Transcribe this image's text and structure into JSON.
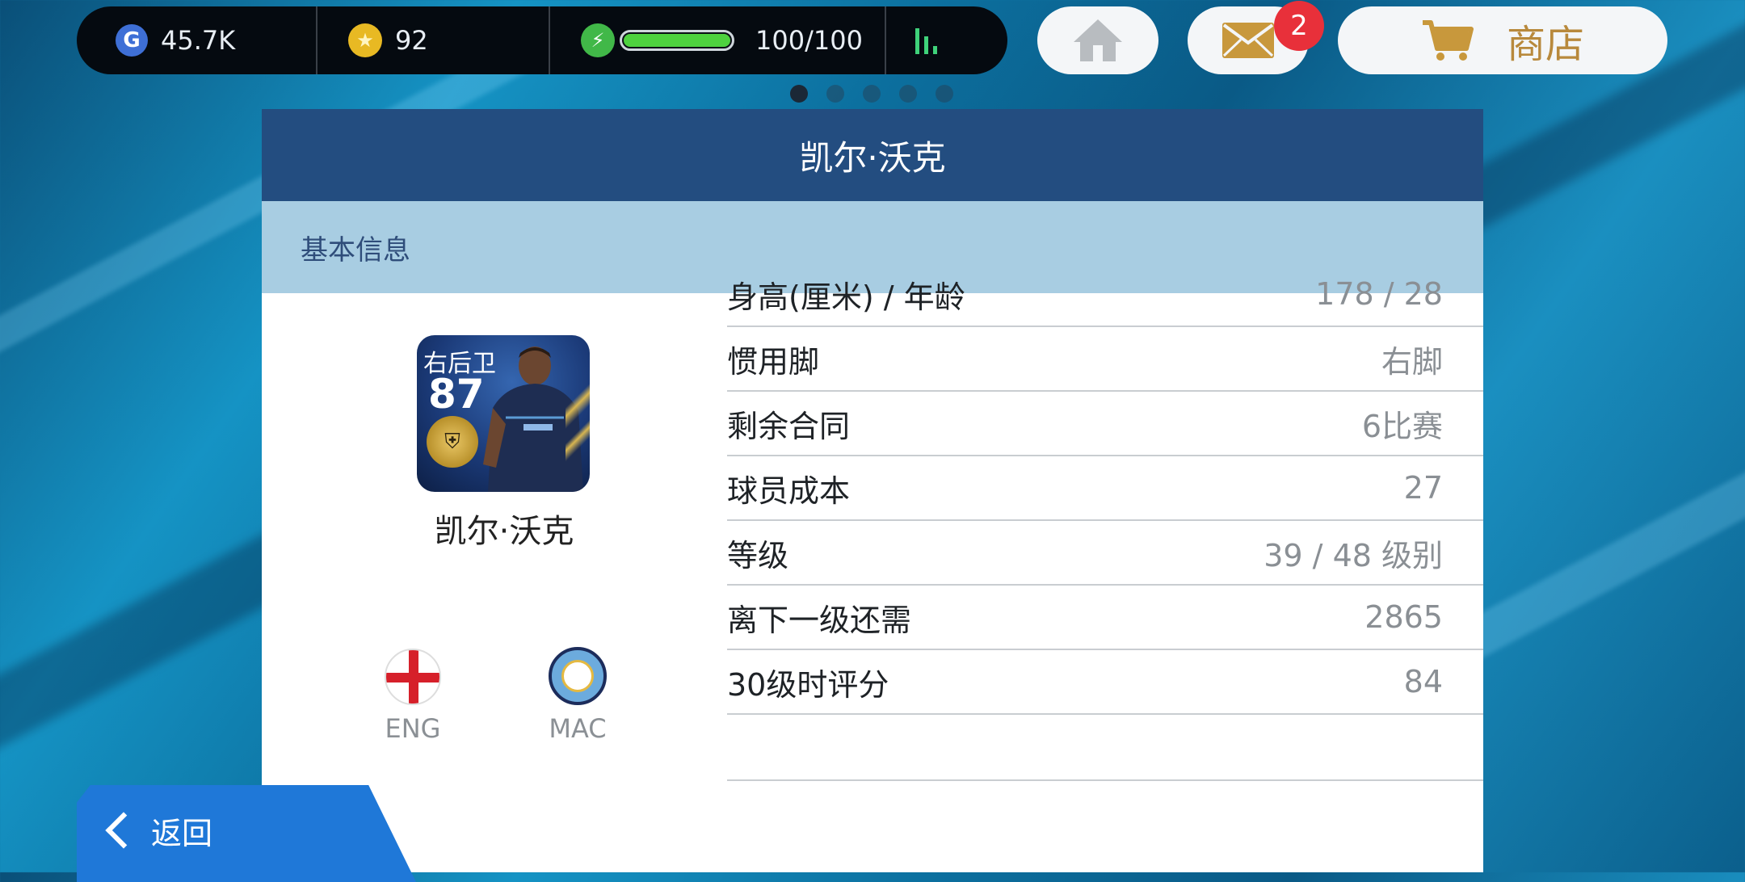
{
  "topbar": {
    "gp": "45.7K",
    "coins": "92",
    "energy_text": "100/100",
    "energy_fraction": 1.0,
    "icons": [
      "g-icon",
      "coin-icon",
      "lightning-icon",
      "signal-icon"
    ]
  },
  "nav": {
    "mail_badge": "2",
    "shop_label": "商店",
    "icons": [
      "home-icon",
      "mail-icon",
      "cart-icon"
    ]
  },
  "page": {
    "title": "凯尔·沃克",
    "section": "基本信息",
    "page_count": 5,
    "active_page": 1
  },
  "player": {
    "position": "右后卫",
    "rating": "87",
    "name": "凯尔·沃克",
    "nation_code": "ENG",
    "club_code": "MAC"
  },
  "info_rows": [
    {
      "label": "身高(厘米) / 年龄",
      "value": "178 / 28"
    },
    {
      "label": "惯用脚",
      "value": "右脚"
    },
    {
      "label": "剩余合同",
      "value": "6比赛"
    },
    {
      "label": "球员成本",
      "value": "27"
    },
    {
      "label": "等级",
      "value": "39 / 48 级别"
    },
    {
      "label": "离下一级还需",
      "value": "2865"
    },
    {
      "label": "30级时评分",
      "value": "84"
    }
  ],
  "back": {
    "label": "返回"
  },
  "colors": {
    "header": "#234d80",
    "section": "#a8cde2",
    "back": "#1f78d8",
    "badge": "#e8303a",
    "energy": "#4ed23f"
  }
}
